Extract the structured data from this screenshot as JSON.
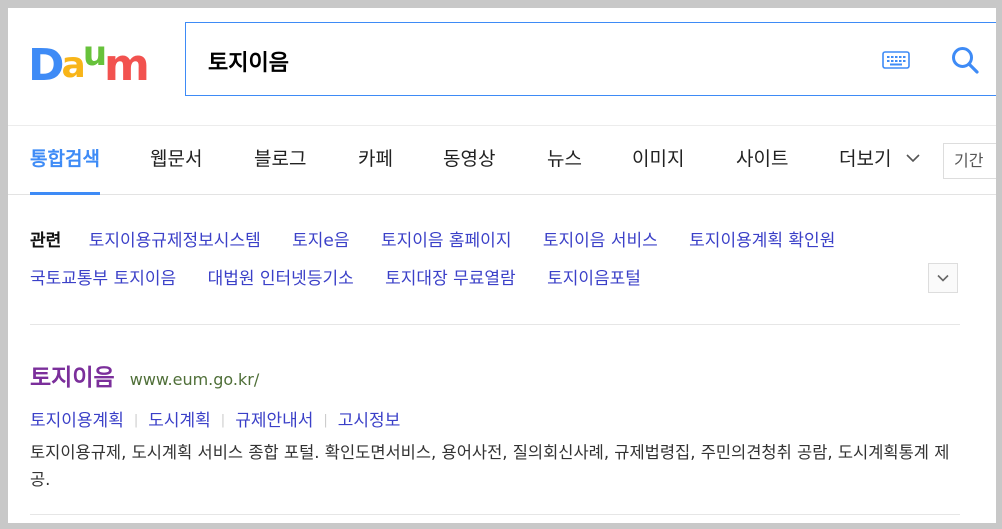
{
  "logo": {
    "letters": [
      "D",
      "a",
      "u",
      "m"
    ],
    "colors": [
      "#3e8bf6",
      "#f8b519",
      "#67c23b",
      "#f2524f"
    ]
  },
  "search": {
    "query": "토지이음",
    "accent": "#3e8bf6"
  },
  "tabs": [
    {
      "label": "통합검색",
      "active": true
    },
    {
      "label": "웹문서"
    },
    {
      "label": "블로그"
    },
    {
      "label": "카페"
    },
    {
      "label": "동영상"
    },
    {
      "label": "뉴스"
    },
    {
      "label": "이미지"
    },
    {
      "label": "사이트"
    },
    {
      "label": "더보기"
    }
  ],
  "period_label": "기간",
  "related": {
    "title": "관련",
    "row1": [
      "토지이용규제정보시스템",
      "토지e음",
      "토지이음 홈페이지",
      "토지이음 서비스",
      "토지이용계획 확인원"
    ],
    "row2": [
      "국토교통부 토지이음",
      "대법원 인터넷등기소",
      "토지대장 무료열람",
      "토지이음포털"
    ]
  },
  "result": {
    "title": "토지이음",
    "url": "www.eum.go.kr/",
    "sublinks": [
      "토지이용계획",
      "도시계획",
      "규제안내서",
      "고시정보"
    ],
    "description": "토지이용규제, 도시계획 서비스 종합 포털. 확인도면서비스, 용어사전, 질의회신사례, 규제법령집, 주민의견청취 공람, 도시계획통계 제공."
  },
  "colors": {
    "link": "#3b40c8",
    "visited_title": "#7b2f9b",
    "url": "#4f6f38"
  }
}
